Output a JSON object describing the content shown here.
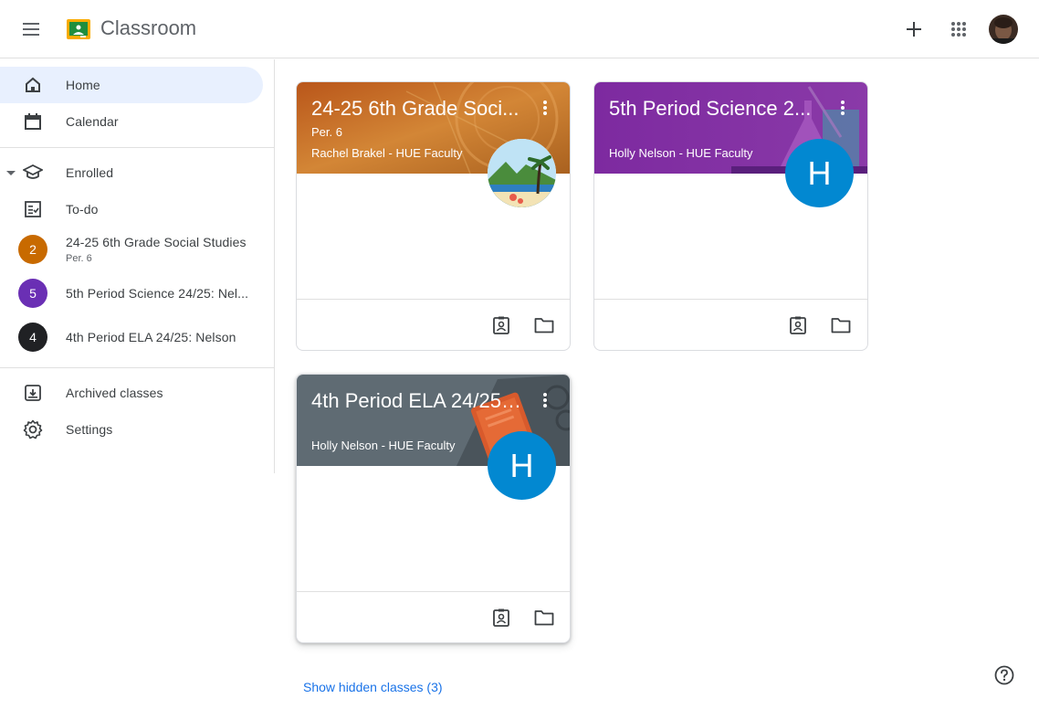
{
  "app": {
    "title": "Classroom",
    "icons": {
      "menu": "hamburger-menu-icon",
      "logo": "classroom-logo",
      "create": "plus-icon",
      "apps": "apps-grid-icon",
      "account": "account-avatar",
      "help": "help-circle-icon"
    }
  },
  "sidebar": {
    "home": {
      "label": "Home",
      "icon": "home-icon"
    },
    "calendar": {
      "label": "Calendar",
      "icon": "calendar-icon"
    },
    "enrolled": {
      "label": "Enrolled",
      "icon": "graduation-cap-icon"
    },
    "todo": {
      "label": "To-do",
      "icon": "todo-list-icon"
    },
    "classes": [
      {
        "badge": "2",
        "label": "24-25 6th Grade Social Studies",
        "sub": "Per. 6",
        "color": "#c86a00"
      },
      {
        "badge": "5",
        "label": "5th Period Science 24/25: Nel...",
        "sub": "",
        "color": "#6a2fb4"
      },
      {
        "badge": "4",
        "label": "4th Period ELA 24/25: Nelson",
        "sub": "",
        "color": "#202124"
      }
    ],
    "archived": {
      "label": "Archived classes",
      "icon": "archive-icon"
    },
    "settings": {
      "label": "Settings",
      "icon": "gear-icon"
    }
  },
  "cards": [
    {
      "title": "24-25 6th Grade Soci...",
      "section": "Per. 6",
      "teacher": "Rachel Brakel - HUE Faculty",
      "theme": "#c9742b",
      "avatar": "photo"
    },
    {
      "title": "5th Period Science 2...",
      "section": "",
      "teacher": "Holly Nelson - HUE Faculty",
      "theme": "#7b2d9e",
      "avatar": "H"
    },
    {
      "title": "4th Period ELA 24/25:...",
      "section": "",
      "teacher": "Holly Nelson - HUE Faculty",
      "theme": "#5f6b73",
      "avatar": "H"
    }
  ],
  "footer": {
    "show_hidden": "Show hidden classes (3)"
  }
}
